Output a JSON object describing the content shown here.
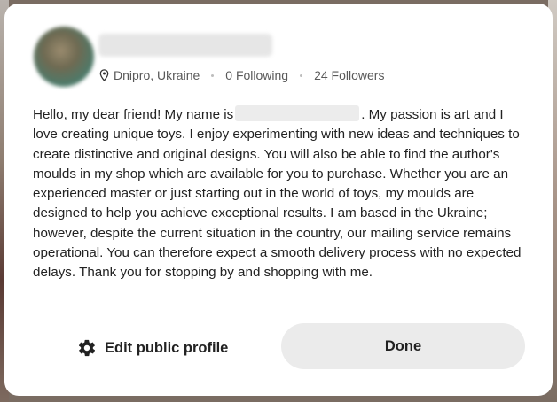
{
  "profile": {
    "location": "Dnipro, Ukraine",
    "following": "0 Following",
    "followers": "24 Followers"
  },
  "bio": {
    "before_name": "Hello, my dear friend! My name is",
    "after_name": ". My passion is art and I love creating unique toys. I enjoy experimenting with new ideas and techniques to create distinctive and original designs. You will also be able to find the author's moulds in my shop which are available for you to purchase. Whether you are an experienced master or just starting out in the world of toys, my moulds are designed to help you achieve exceptional results. I am based in the Ukraine; however, despite the current situation in the country, our mailing service remains operational. You can therefore expect a smooth delivery process with no expected delays. Thank you for stopping by and shopping with me."
  },
  "actions": {
    "edit_label": "Edit public profile",
    "done_label": "Done"
  },
  "icons": {
    "location": "map-pin-icon",
    "edit": "gear-icon"
  }
}
